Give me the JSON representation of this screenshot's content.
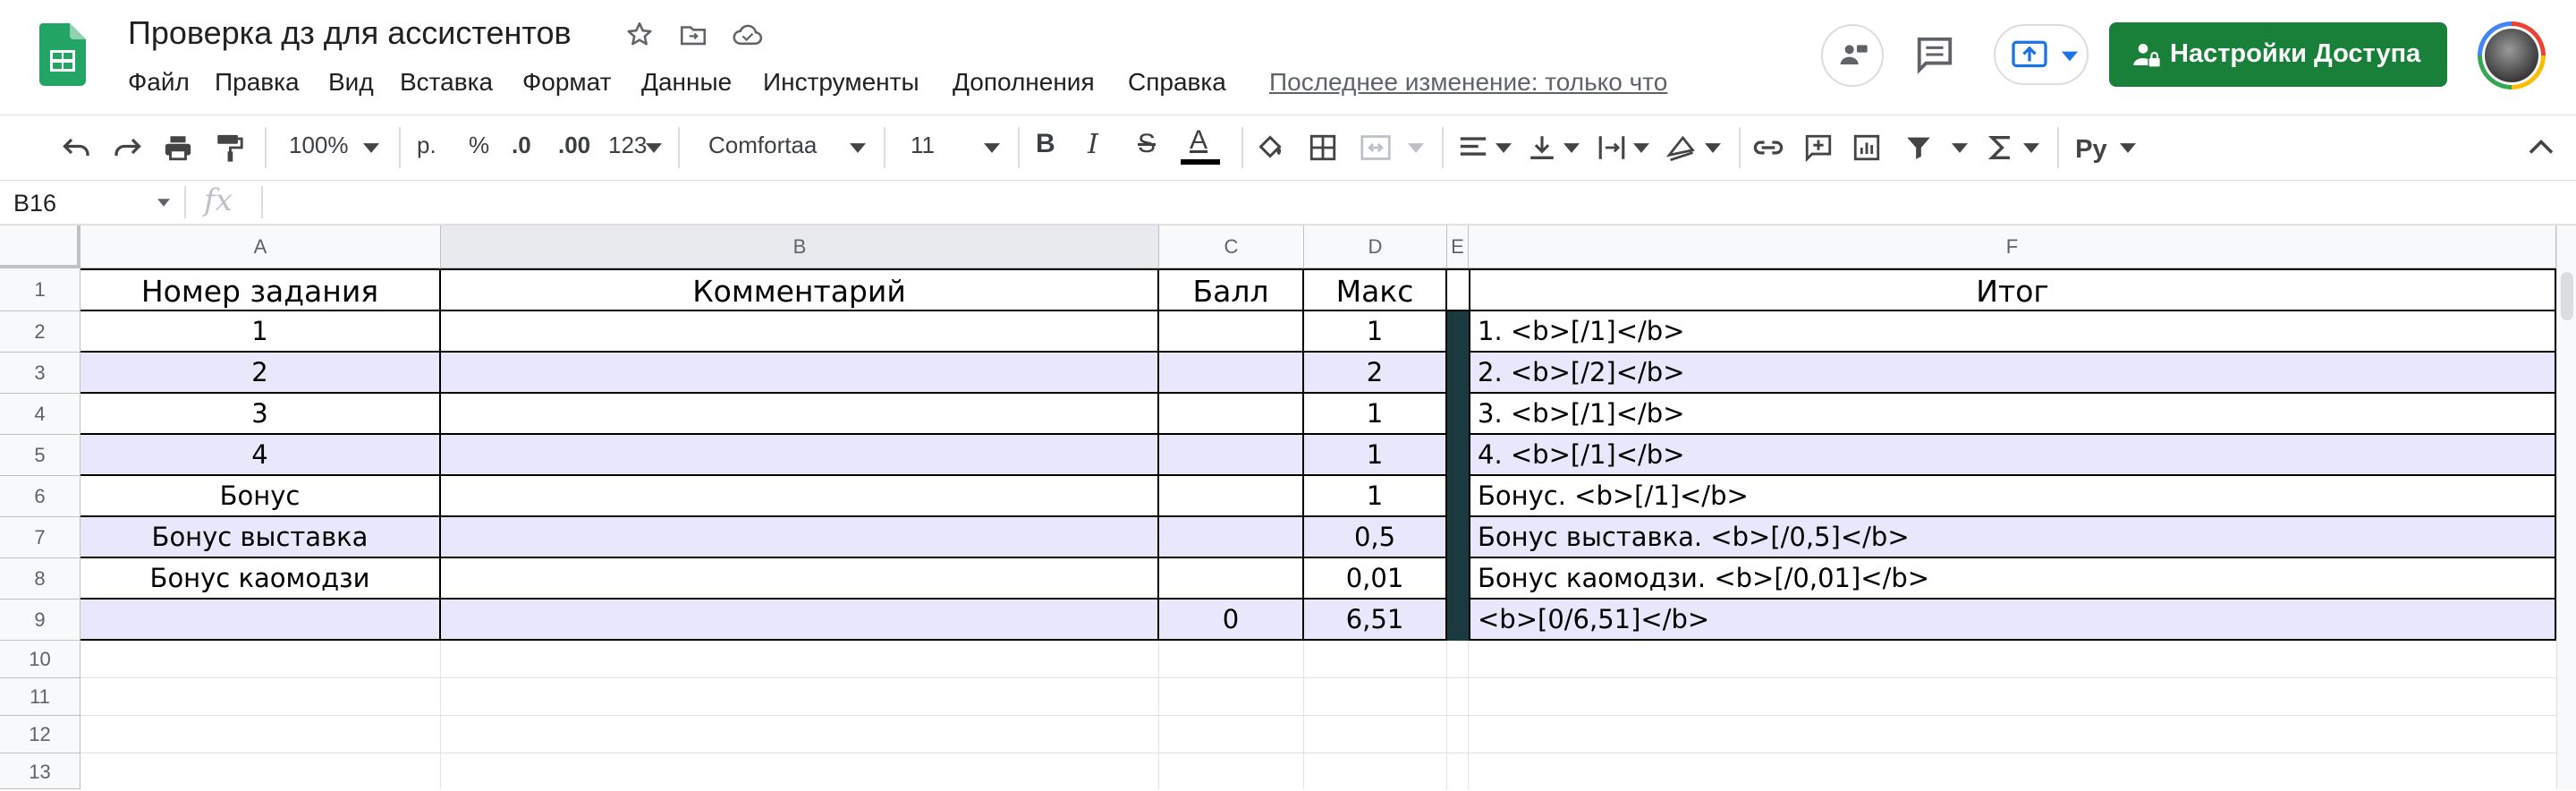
{
  "doc": {
    "title": "Проверка дз для ассистентов",
    "last_edit": "Последнее изменение: только что"
  },
  "menu": [
    "Файл",
    "Правка",
    "Вид",
    "Вставка",
    "Формат",
    "Данные",
    "Инструменты",
    "Дополнения",
    "Справка"
  ],
  "share_button": "Настройки Доступа",
  "toolbar": {
    "zoom": "100%",
    "currency": "р.",
    "percent": "%",
    "dec_less": ".0",
    "dec_more": ".00",
    "format_more": "123",
    "font": "Comfortaa",
    "font_size": "11",
    "bold": "B",
    "italic": "I",
    "strike": "S",
    "text_color": "A"
  },
  "formula_bar": {
    "name_box": "B16",
    "fx": "fx"
  },
  "columns": [
    "A",
    "B",
    "C",
    "D",
    "E",
    "F"
  ],
  "row_numbers": [
    "1",
    "2",
    "3",
    "4",
    "5",
    "6",
    "7",
    "8",
    "9",
    "10",
    "11",
    "12",
    "13"
  ],
  "sheet": {
    "headers": {
      "a": "Номер задания",
      "b": "Комментарий",
      "c": "Балл",
      "d": "Макс",
      "f": "Итог"
    },
    "rows": [
      {
        "a": "1",
        "b": "",
        "c": "",
        "d": "1",
        "f": "1. <b>[/1]</b>"
      },
      {
        "a": "2",
        "b": "",
        "c": "",
        "d": "2",
        "f": "2. <b>[/2]</b>"
      },
      {
        "a": "3",
        "b": "",
        "c": "",
        "d": "1",
        "f": "3. <b>[/1]</b>"
      },
      {
        "a": "4",
        "b": "",
        "c": "",
        "d": "1",
        "f": "4. <b>[/1]</b>"
      },
      {
        "a": "Бонус",
        "b": "",
        "c": "",
        "d": "1",
        "f": "Бонус. <b>[/1]</b>"
      },
      {
        "a": "Бонус выставка",
        "b": "",
        "c": "",
        "d": "0,5",
        "f": "Бонус выставка. <b>[/0,5]</b>"
      },
      {
        "a": "Бонус каомодзи",
        "b": "",
        "c": "",
        "d": "0,01",
        "f": "Бонус каомодзи. <b>[/0,01]</b>"
      },
      {
        "a": "",
        "b": "",
        "c": "0",
        "d": "6,51",
        "f": "<b>[0/6,51]</b>"
      }
    ]
  },
  "colors": {
    "brand_green": "#188038",
    "band_lavender": "#e8e7fc",
    "separator_dark": "#1b3a40",
    "grid_border": "#000000"
  },
  "icons": [
    "sheets-logo",
    "star-icon",
    "move-icon",
    "cloud-icon",
    "comment-history-icon",
    "comment-icon",
    "present-icon",
    "lock-person-icon",
    "avatar"
  ]
}
